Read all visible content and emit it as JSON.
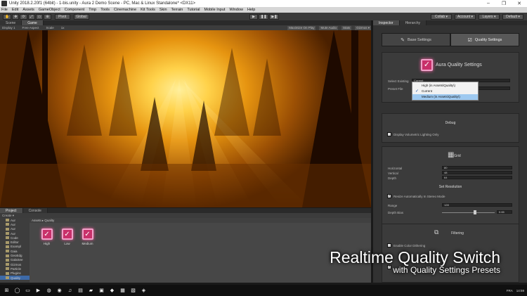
{
  "window": {
    "title": "Unity 2018.2.20f1 (64bit) - 1-bis.unity - Aura 2 Demo Scene - PC, Mac & Linux Standalone* <DX11>",
    "controls": [
      "–",
      "❐",
      "✕"
    ]
  },
  "menu": [
    "File",
    "Edit",
    "Assets",
    "GameObject",
    "Component",
    "Tmp",
    "Tools",
    "Cinemachine",
    "Kit Tools",
    "Skin",
    "Terrain",
    "Tutorial",
    "Mobile Input",
    "Window",
    "Help"
  ],
  "toolbar": {
    "tools": [
      "✋",
      "✥",
      "⟳",
      "⤢",
      "▭",
      "⊕"
    ],
    "pivot": "Pivot",
    "global": "Global",
    "play": "▶",
    "pause": "❚❚",
    "step": "▶❚",
    "collab": "Collab ▾",
    "account": "Account ▾",
    "layers": "Layers ▾",
    "layout": "Default ▾"
  },
  "scene_panel": {
    "tabs": [
      "Scene",
      "Game"
    ],
    "display": "Display 1",
    "aspect": "Free Aspect",
    "scale": "Scale",
    "scale_value": "1x",
    "right_controls": [
      "Maximize On Play",
      "Mute Audio",
      "Stats",
      "Gizmos ▾"
    ]
  },
  "project_panel": {
    "tabs": [
      "Project",
      "Console"
    ],
    "create": "Create ▾",
    "tree": [
      "Aur",
      "Aur",
      "Aur",
      "Aur",
      "Code",
      "Editor",
      "Exampl",
      "Gaia",
      "GeoEdg",
      "GalaSee",
      "Gizmos",
      "Particle",
      "Plugins",
      "Quality"
    ],
    "breadcrumb": "Assets ▸ Quality",
    "assets": [
      {
        "label": "High"
      },
      {
        "label": "Low"
      },
      {
        "label": "Medium"
      }
    ]
  },
  "inspector": {
    "tabs": [
      "Inspector",
      "Hierarchy"
    ],
    "base_tab": "Base Settings",
    "quality_tab": "Quality Settings",
    "header_title": "Aura Quality Settings",
    "select_existing_label": "Select Existing",
    "select_existing_value": "Current",
    "preset_file_label": "Preset File",
    "dropdown_options": [
      {
        "label": "High (in Assets\\Quality\\)",
        "checked": false,
        "highlighted": false
      },
      {
        "label": "Current",
        "checked": true,
        "highlighted": false
      },
      {
        "label": "Medium (in Assets\\Quality\\)",
        "checked": false,
        "highlighted": true
      }
    ],
    "debug_title": "Debug",
    "display_volumetric_label": "Display Volumetric Lighting Only",
    "grid_title": "Grid",
    "horizontal_label": "Horizontal",
    "horizontal_value": "80",
    "vertical_label": "Vertical",
    "vertical_value": "48",
    "depth_label": "Depth",
    "depth_value": "64",
    "set_resolution_title": "Set Resolution",
    "resize_auto_label": "Resize Automatically In Stereo Mode",
    "range_label": "Range",
    "range_value": "128",
    "depth_bias_label": "Depth Bias",
    "depth_bias_value": "0.65",
    "filtering_title": "Filtering",
    "enable_color_dithering_label": "Enable Color Dithering"
  },
  "caption": {
    "line1": "Realtime Quality Switch",
    "line2": "with Quality Settings Presets"
  },
  "taskbar": {
    "start": "⊞",
    "apps": [
      "◯",
      "▭",
      "▶",
      "◍",
      "◉",
      "♫",
      "▤",
      "▰",
      "▣",
      "◆",
      "▦",
      "▧",
      "◈"
    ],
    "lang": "FRA",
    "time": "14:59"
  }
}
